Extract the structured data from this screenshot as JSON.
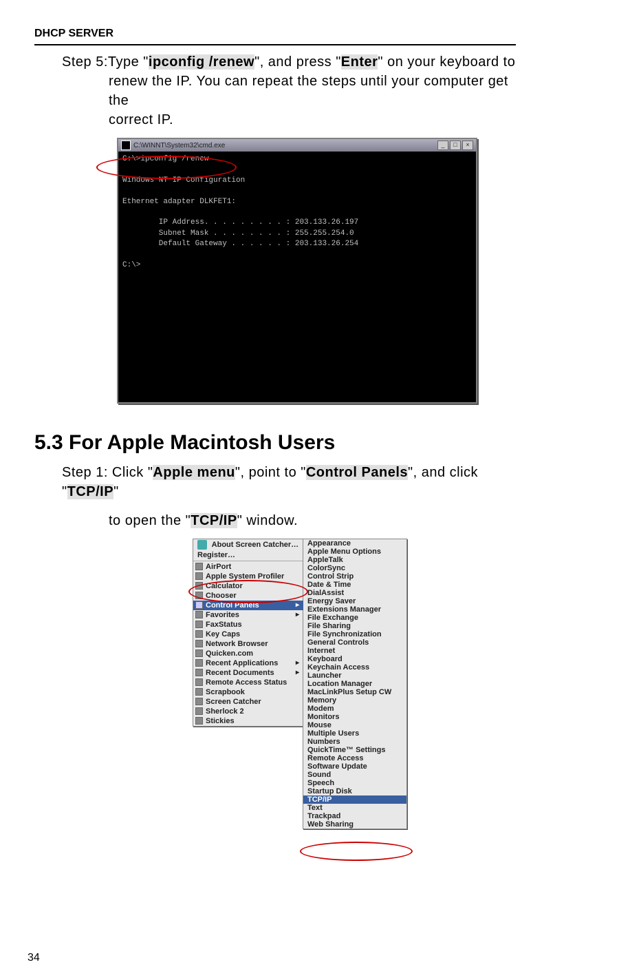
{
  "header": "DHCP SERVER",
  "step5": {
    "prefix": "Step 5:",
    "t1": "Type \"",
    "cmd": "ipconfig /renew",
    "t2": "\", and press \"",
    "key": "Enter",
    "t3": "\" on your keyboard to",
    "line2": "renew the IP. You can repeat the steps until your computer get the",
    "line3": "correct IP."
  },
  "terminal": {
    "title": "C:\\WINNT\\System32\\cmd.exe",
    "lines": [
      "C:\\>ipconfig /renew",
      "",
      "Windows NT IP Configuration",
      "",
      "Ethernet adapter DLKFET1:",
      "",
      "        IP Address. . . . . . . . . : 203.133.26.197",
      "        Subnet Mask . . . . . . . . : 255.255.254.0",
      "        Default Gateway . . . . . . : 203.133.26.254",
      "",
      "C:\\>"
    ]
  },
  "section": "5.3 For Apple Macintosh Users",
  "step1": {
    "prefix": "Step 1: Click \"",
    "apple": "Apple menu",
    "t1": "\", point to \"",
    "cp": "Control Panels",
    "t2": "\", and click \"",
    "tcp": "TCP/IP",
    "t3": "\"",
    "line2a": "to open the \"",
    "tcp2": "TCP/IP",
    "line2b": "\" window."
  },
  "mac_left": {
    "top1": "About Screen Catcher…",
    "top2": "Register…",
    "items": [
      "AirPort",
      "Apple System Profiler",
      "Calculator",
      "Chooser",
      "Control Panels",
      "Favorites",
      "FaxStatus",
      "Key Caps",
      "Network Browser",
      "Quicken.com",
      "Recent Applications",
      "Recent Documents",
      "Remote Access Status",
      "Scrapbook",
      "Screen Catcher",
      "Sherlock 2",
      "Stickies"
    ]
  },
  "mac_right": [
    "Appearance",
    "Apple Menu Options",
    "AppleTalk",
    "ColorSync",
    "Control Strip",
    "Date & Time",
    "DialAssist",
    "Energy Saver",
    "Extensions Manager",
    "File Exchange",
    "File Sharing",
    "File Synchronization",
    "General Controls",
    "Internet",
    "Keyboard",
    "Keychain Access",
    "Launcher",
    "Location Manager",
    "MacLinkPlus Setup CW",
    "Memory",
    "Modem",
    "Monitors",
    "Mouse",
    "Multiple Users",
    "Numbers",
    "QuickTime™ Settings",
    "Remote Access",
    "Software Update",
    "Sound",
    "Speech",
    "Startup Disk",
    "TCP/IP",
    "Text",
    "Trackpad",
    "Web Sharing"
  ],
  "page": "34"
}
